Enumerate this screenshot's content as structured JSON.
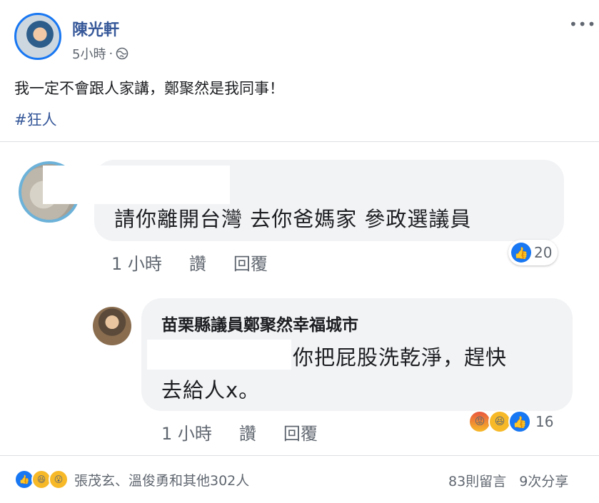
{
  "post": {
    "author": "陳光軒",
    "time": "5小時",
    "separator": "·",
    "privacy_icon": "globe-icon",
    "more_icon": "•••",
    "text": "我一定不會跟人家講，鄭聚然是我同事！",
    "hashtag": "#狂人"
  },
  "comments": [
    {
      "text": "請你離開台灣 去你爸媽家 參政選議員",
      "time": "1 小時",
      "like_label": "讚",
      "reply_label": "回覆",
      "reaction_count": "20"
    },
    {
      "author": "苗栗縣議員鄭聚然幸福城市",
      "text_line1": "你把屁股洗乾淨，趕快",
      "text_line2": "去給人x。",
      "time": "1 小時",
      "like_label": "讚",
      "reply_label": "回覆",
      "reaction_count": "16"
    }
  ],
  "footer": {
    "reactions_summary": "張茂玄、溫俊勇和其他302人",
    "comments_count": "83則留言",
    "shares_count": "9次分享"
  },
  "colors": {
    "link": "#365899",
    "like_blue": "#1877f2",
    "bubble": "#f2f3f5",
    "muted": "#606770"
  }
}
